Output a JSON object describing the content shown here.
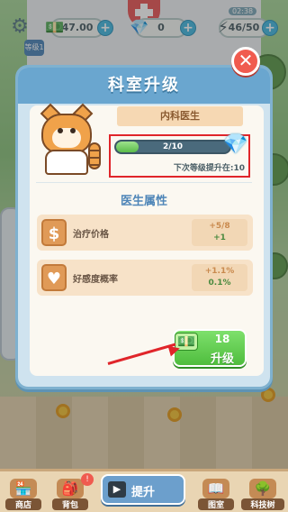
{
  "topbar": {
    "money": "47.00",
    "gems": "0",
    "energy": "46/50",
    "energy_badge": "02:38",
    "level_badge": "等级1"
  },
  "modal": {
    "title": "科室升级",
    "doctor_name": "内科医生",
    "progress_text": "2/10",
    "progress_fraction": 0.2,
    "next_level_text": "下次等级提升在:10",
    "section_title": "医生属性",
    "attributes": [
      {
        "icon": "$",
        "label": "治疗价格",
        "value": "+5/8",
        "delta": "+1"
      },
      {
        "icon": "♥",
        "label": "好感度概率",
        "value": "+1.1%",
        "delta": "0.1%"
      }
    ],
    "upgrade": {
      "cost": "18",
      "label": "升级"
    }
  },
  "bottombar": {
    "shop": "商店",
    "bag": "背包",
    "bag_badge": "!",
    "main": "提升",
    "atlas": "图室",
    "tech": "科技树"
  },
  "colors": {
    "highlight": "#e0252a",
    "modal_header": "#6aa6cf",
    "upgrade_button": "#4fbd3e"
  }
}
